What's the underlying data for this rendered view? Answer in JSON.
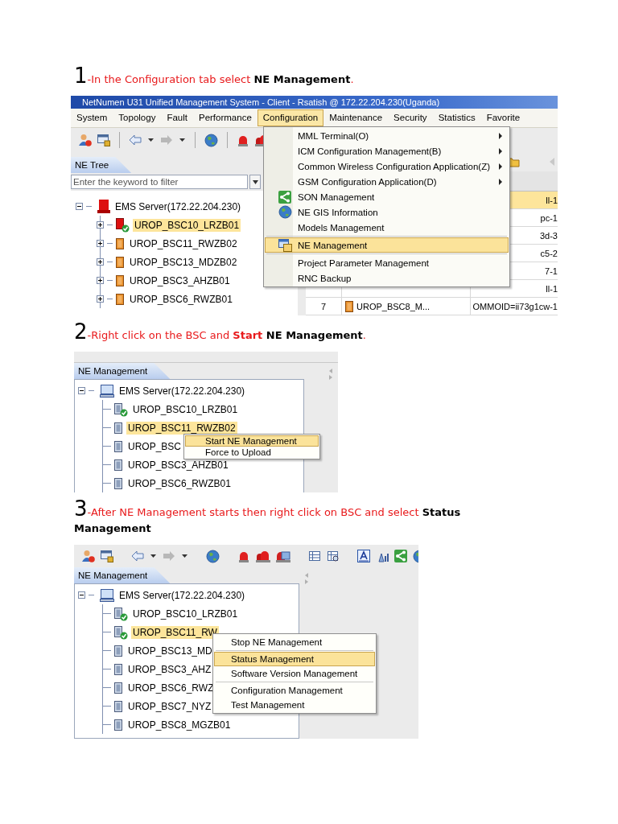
{
  "steps": [
    {
      "number": "1",
      "segments": [
        {
          "text": "-In the Configuration tab select ",
          "kind": "plain"
        },
        {
          "text": "NE Management",
          "kind": "key"
        },
        {
          "text": ".",
          "kind": "plain"
        }
      ],
      "screenshot": {
        "kind": "window",
        "title": "NetNumen U31 Unified Management System - Client - Rsatish @ 172.22.204.230(Uganda)",
        "menubar": [
          {
            "label": "System",
            "selected": false
          },
          {
            "label": "Topology",
            "selected": false
          },
          {
            "label": "Fault",
            "selected": false
          },
          {
            "label": "Performance",
            "selected": false
          },
          {
            "label": "Configuration",
            "selected": true
          },
          {
            "label": "Maintenance",
            "selected": false
          },
          {
            "label": "Security",
            "selected": false
          },
          {
            "label": "Statistics",
            "selected": false
          },
          {
            "label": "Favorite",
            "selected": false
          }
        ],
        "tab": "NE Tree",
        "filter": {
          "placeholder": "Enter the keyword to filter"
        },
        "tree": {
          "label": "EMS Server(172.22.204.230)",
          "expanded": true,
          "children": [
            {
              "label": "UROP_BSC10_LRZB01",
              "selected": true,
              "managed": true,
              "expanded": false
            },
            {
              "label": "UROP_BSC11_RWZB02",
              "selected": false,
              "managed": false,
              "expanded": false
            },
            {
              "label": "UROP_BSC13_MDZB02",
              "selected": false,
              "managed": false,
              "expanded": false
            },
            {
              "label": "UROP_BSC3_AHZB01",
              "selected": false,
              "managed": false,
              "expanded": false
            },
            {
              "label": "UROP_BSC6_RWZB01",
              "selected": false,
              "managed": false,
              "expanded": false
            }
          ]
        },
        "table": {
          "rows": [
            {
              "cells": [
                "ll-1"
              ],
              "selected": true
            },
            {
              "cells": [
                "pc-1"
              ],
              "selected": false
            },
            {
              "cells": [
                "3d-3"
              ],
              "selected": false
            },
            {
              "cells": [
                "c5-2"
              ],
              "selected": false
            },
            {
              "cells": [
                "7-1"
              ],
              "selected": false
            },
            {
              "cells": [
                "ll-1"
              ],
              "selected": false
            },
            {
              "cells": [
                "7",
                "UROP_BSC8_M...",
                "OMMOID=ii73g1cw-1"
              ],
              "selected": false
            }
          ]
        },
        "menu": {
          "kind": "dropdown",
          "items": [
            {
              "label": "MML Terminal(O)",
              "kind": "submenu",
              "selected": false,
              "separator_after": false
            },
            {
              "label": "ICM Configuration Management(B)",
              "kind": "submenu",
              "selected": false,
              "separator_after": false
            },
            {
              "label": "Common Wireless Configuration Application(Z)",
              "kind": "submenu",
              "selected": false,
              "separator_after": false
            },
            {
              "label": "GSM Configuration Application(D)",
              "kind": "submenu",
              "selected": false,
              "separator_after": false
            },
            {
              "label": "SON Management",
              "kind": "icon",
              "selected": false,
              "separator_after": false
            },
            {
              "label": "NE GIS Information",
              "kind": "icon",
              "selected": false,
              "separator_after": false
            },
            {
              "label": "Models Management",
              "kind": "plain",
              "selected": false,
              "separator_after": true
            },
            {
              "label": "NE Management",
              "kind": "icon",
              "selected": true,
              "separator_after": true
            },
            {
              "label": "Project Parameter Management",
              "kind": "plain",
              "selected": false,
              "separator_after": false
            },
            {
              "label": "RNC Backup",
              "kind": "plain",
              "selected": false,
              "separator_after": false
            }
          ]
        }
      }
    },
    {
      "number": "2",
      "segments": [
        {
          "text": "-Right click on the BSC and ",
          "kind": "plain"
        },
        {
          "text": "Start ",
          "kind": "strong"
        },
        {
          "text": "NE Management",
          "kind": "key"
        },
        {
          "text": ".",
          "kind": "plain"
        }
      ],
      "screenshot": {
        "kind": "panel",
        "tab": "NE Management",
        "tree": {
          "label": "EMS Server(172.22.204.230)",
          "expanded": true,
          "children": [
            {
              "label": "UROP_BSC10_LRZB01",
              "selected": false,
              "managed": true
            },
            {
              "label": "UROP_BSC11_RWZB02",
              "selected": true,
              "managed": false
            },
            {
              "label": "UROP_BSC",
              "selected": false,
              "managed": false
            },
            {
              "label": "UROP_BSC3_AHZB01",
              "selected": false,
              "managed": false
            },
            {
              "label": "UROP_BSC6_RWZB01",
              "selected": false,
              "managed": false
            }
          ]
        },
        "menu": {
          "kind": "context",
          "items": [
            {
              "label": "Start NE Management",
              "kind": "plain",
              "selected": true,
              "separator_after": false
            },
            {
              "label": "Force to Upload",
              "kind": "plain",
              "selected": false,
              "separator_after": false
            }
          ]
        }
      }
    },
    {
      "number": "3",
      "segments": [
        {
          "text": "-After NE Management starts then right click on BSC and select ",
          "kind": "plain"
        },
        {
          "text": "Status Management",
          "kind": "key"
        }
      ],
      "screenshot": {
        "kind": "panel-toolbar",
        "tab": "NE Management",
        "tree": {
          "label": "EMS Server(172.22.204.230)",
          "expanded": true,
          "children": [
            {
              "label": "UROP_BSC10_LRZB01",
              "selected": false,
              "managed": true
            },
            {
              "label": "UROP_BSC11_RW",
              "selected": true,
              "managed": true
            },
            {
              "label": "UROP_BSC13_MD",
              "selected": false,
              "managed": false
            },
            {
              "label": "UROP_BSC3_AHZ",
              "selected": false,
              "managed": false
            },
            {
              "label": "UROP_BSC6_RWZ",
              "selected": false,
              "managed": false
            },
            {
              "label": "UROP_BSC7_NYZ",
              "selected": false,
              "managed": false
            },
            {
              "label": "UROP_BSC8_MGZB01",
              "selected": false,
              "managed": false
            }
          ]
        },
        "menu": {
          "kind": "context",
          "items": [
            {
              "label": "Stop NE Management",
              "kind": "plain",
              "selected": false,
              "separator_after": true
            },
            {
              "label": "Status Management",
              "kind": "plain",
              "selected": true,
              "separator_after": false
            },
            {
              "label": "Software Version Management",
              "kind": "plain",
              "selected": false,
              "separator_after": true
            },
            {
              "label": "Configuration Management",
              "kind": "plain",
              "selected": false,
              "separator_after": false
            },
            {
              "label": "Test Management",
              "kind": "plain",
              "selected": false,
              "separator_after": false
            }
          ]
        }
      }
    }
  ]
}
